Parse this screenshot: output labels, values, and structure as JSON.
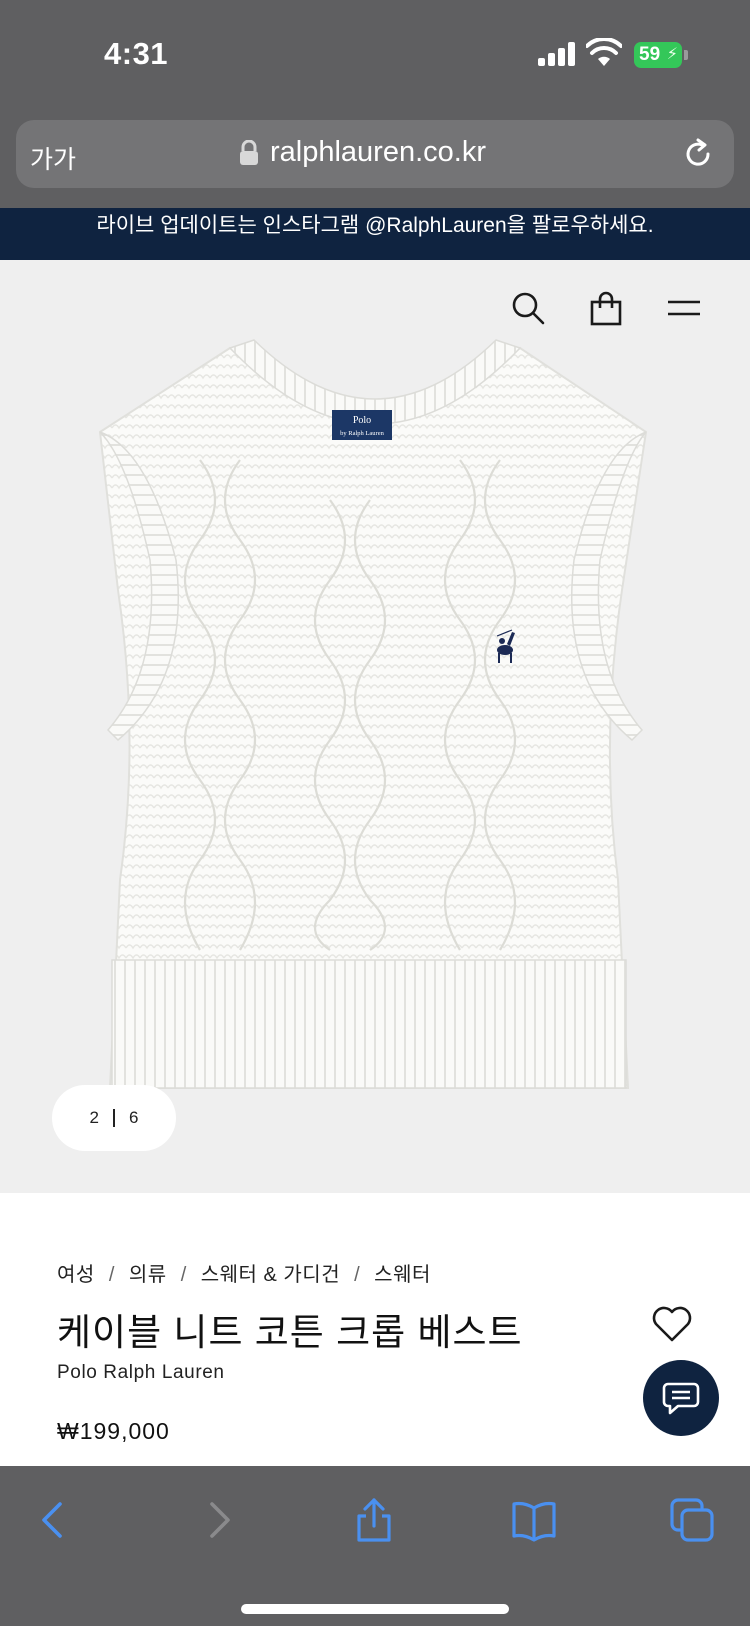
{
  "status": {
    "time": "4:31",
    "battery": "59"
  },
  "browser": {
    "text_size_label": "가가",
    "url": "ralphlauren.co.kr"
  },
  "announcement": {
    "text": "라이브 업데이트는 인스타그램 @RalphLauren을 팔로우하세요."
  },
  "gallery": {
    "current": "2",
    "total": "6"
  },
  "product": {
    "breadcrumb": [
      "여성",
      "의류",
      "스웨터 & 가디건",
      "스웨터"
    ],
    "title": "케이블 니트 코튼 크롭 베스트",
    "brand": "Polo Ralph Lauren",
    "price": "₩199,000",
    "label_text": "Polo",
    "label_subtext": "by Ralph Lauren"
  },
  "colors": {
    "navy": "#0f2340",
    "chrome": "#5f5f61",
    "hero_bg": "#efefef",
    "safari_blue": "#4a90f0"
  },
  "icons": [
    "search-icon",
    "shopping-bag-icon",
    "menu-icon",
    "heart-icon",
    "chat-icon",
    "back-icon",
    "forward-icon",
    "share-icon",
    "bookmarks-icon",
    "tabs-icon",
    "lock-icon",
    "reload-icon"
  ]
}
